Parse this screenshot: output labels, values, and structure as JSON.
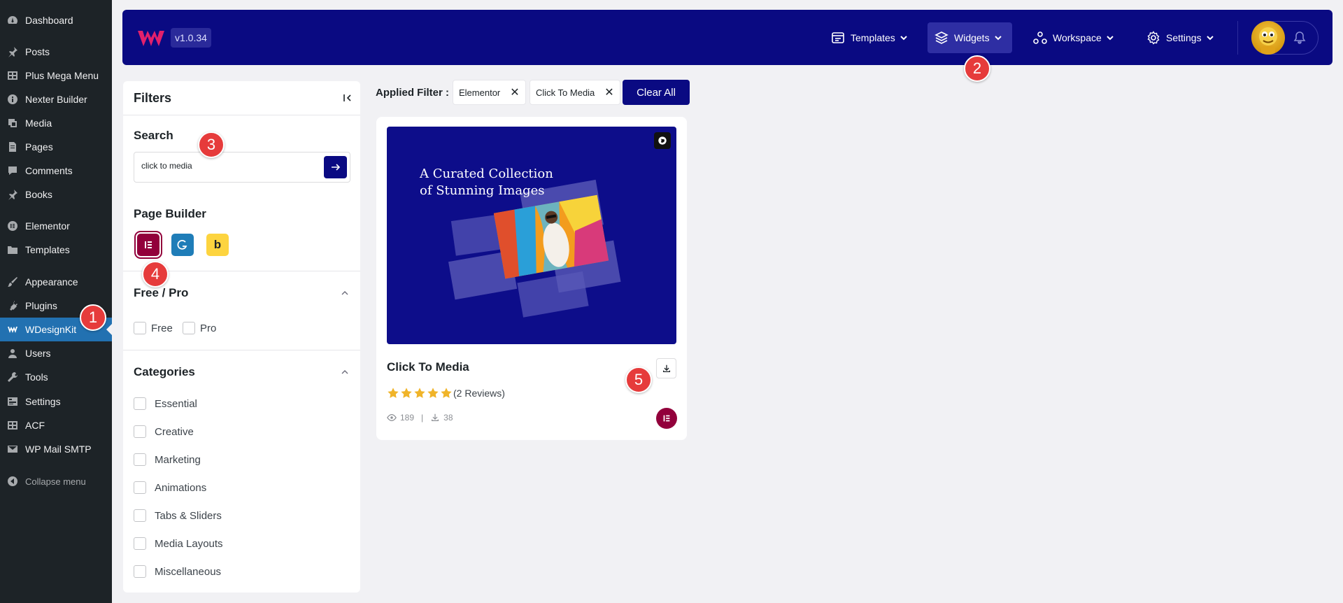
{
  "wp_sidebar": {
    "items": [
      {
        "label": "Dashboard",
        "icon": "dashboard-icon"
      },
      {
        "label": "Posts",
        "icon": "pin-icon"
      },
      {
        "label": "Plus Mega Menu",
        "icon": "grid-icon"
      },
      {
        "label": "Nexter Builder",
        "icon": "info-icon"
      },
      {
        "label": "Media",
        "icon": "media-icon"
      },
      {
        "label": "Pages",
        "icon": "page-icon"
      },
      {
        "label": "Comments",
        "icon": "comment-icon"
      },
      {
        "label": "Books",
        "icon": "pin-icon"
      },
      {
        "label": "Elementor",
        "icon": "elementor-icon"
      },
      {
        "label": "Templates",
        "icon": "folder-icon"
      },
      {
        "label": "Appearance",
        "icon": "brush-icon"
      },
      {
        "label": "Plugins",
        "icon": "plug-icon"
      },
      {
        "label": "WDesignKit",
        "icon": "wdesignkit-icon"
      },
      {
        "label": "Users",
        "icon": "user-icon"
      },
      {
        "label": "Tools",
        "icon": "wrench-icon"
      },
      {
        "label": "Settings",
        "icon": "settings-icon"
      },
      {
        "label": "ACF",
        "icon": "grid-icon"
      },
      {
        "label": "WP Mail SMTP",
        "icon": "mail-icon"
      },
      {
        "label": "Collapse menu",
        "icon": "collapse-icon"
      }
    ],
    "active": "WDesignKit"
  },
  "header": {
    "version": "v1.0.34",
    "nav": [
      {
        "label": "Templates",
        "icon": "templates-icon"
      },
      {
        "label": "Widgets",
        "icon": "layers-icon",
        "active": true
      },
      {
        "label": "Workspace",
        "icon": "workspace-icon"
      },
      {
        "label": "Settings",
        "icon": "gear-icon"
      }
    ]
  },
  "filters": {
    "title": "Filters",
    "search": {
      "title": "Search",
      "value": "click to media"
    },
    "page_builder": {
      "title": "Page Builder",
      "builders": [
        "Elementor",
        "Gutenberg",
        "Bricks"
      ],
      "selected": "Elementor",
      "bricks_glyph": "b"
    },
    "free_pro": {
      "title": "Free / Pro",
      "options": [
        "Free",
        "Pro"
      ]
    },
    "categories": {
      "title": "Categories",
      "options": [
        "Essential",
        "Creative",
        "Marketing",
        "Animations",
        "Tabs & Sliders",
        "Media Layouts",
        "Miscellaneous"
      ]
    }
  },
  "applied": {
    "label": "Applied Filter :",
    "chips": [
      "Elementor",
      "Click To Media"
    ],
    "chip_close": "✕",
    "clear_label": "Clear All"
  },
  "card": {
    "image_title_line1": "A Curated Collection",
    "image_title_line2": "of Stunning Images",
    "title": "Click To Media",
    "rating": 5,
    "reviews": "(2 Reviews)",
    "views": "189",
    "separator": "|",
    "downloads": "38",
    "builder": "Elementor"
  },
  "steps": [
    "1",
    "2",
    "3",
    "4",
    "5"
  ],
  "colors": {
    "brand": "#0a0a82",
    "elementor": "#92003b",
    "marker": "#e63b3b",
    "star": "#f0b429"
  }
}
